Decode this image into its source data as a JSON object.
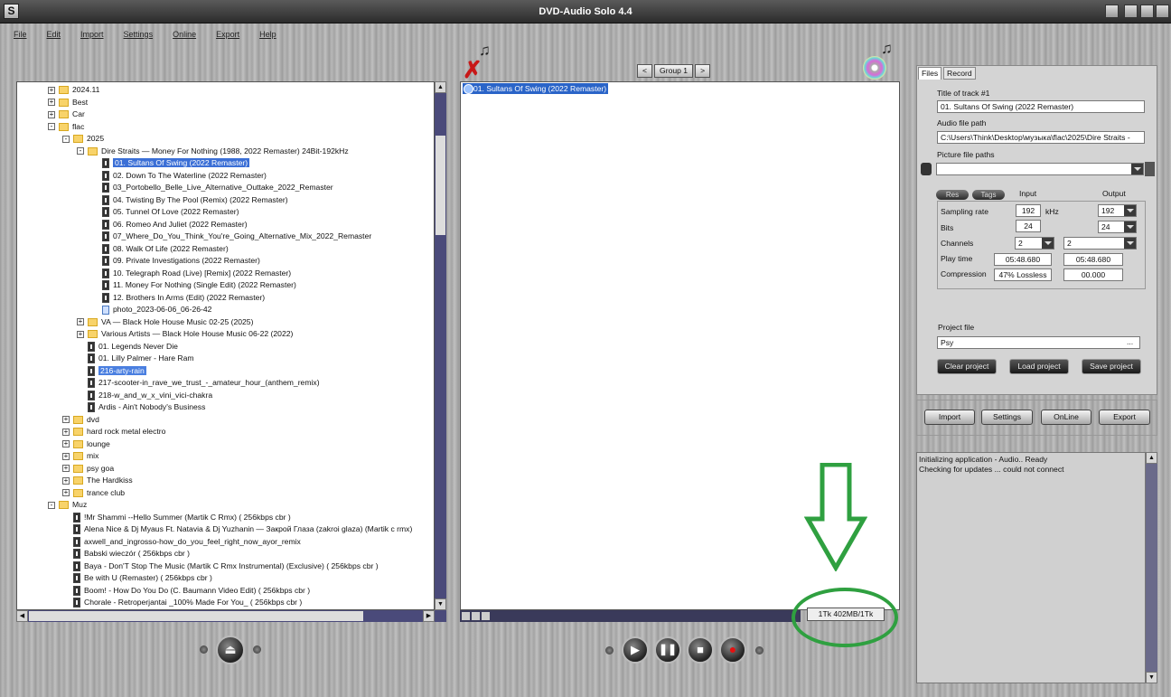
{
  "app": {
    "title": "DVD-Audio Solo 4.4",
    "logo_letter": "S"
  },
  "menu": [
    "File",
    "Edit",
    "Import",
    "Settings",
    "Online",
    "Export",
    "Help"
  ],
  "tree": {
    "rows": [
      {
        "t": "2024.11",
        "type": "folder",
        "lvl": 2,
        "pm": "+"
      },
      {
        "t": "Best",
        "type": "folder",
        "lvl": 2,
        "pm": "+"
      },
      {
        "t": "Car",
        "type": "folder",
        "lvl": 2,
        "pm": "+"
      },
      {
        "t": "flac",
        "type": "folder",
        "lvl": 2,
        "pm": "-"
      },
      {
        "t": "2025",
        "type": "folder",
        "lvl": 3,
        "pm": "-"
      },
      {
        "t": "Dire Straits — Money For Nothing (1988, 2022 Remaster) 24Bit-192kHz",
        "type": "folder",
        "lvl": 4,
        "pm": "-"
      },
      {
        "t": "01. Sultans Of Swing (2022 Remaster)",
        "type": "file",
        "lvl": 5,
        "sel": 1
      },
      {
        "t": "02. Down To The Waterline (2022 Remaster)",
        "type": "file",
        "lvl": 5
      },
      {
        "t": "03_Portobello_Belle_Live_Alternative_Outtake_2022_Remaster",
        "type": "file",
        "lvl": 5
      },
      {
        "t": "04. Twisting By The Pool (Remix) (2022 Remaster)",
        "type": "file",
        "lvl": 5
      },
      {
        "t": "05. Tunnel Of Love (2022 Remaster)",
        "type": "file",
        "lvl": 5
      },
      {
        "t": "06. Romeo And Juliet (2022 Remaster)",
        "type": "file",
        "lvl": 5
      },
      {
        "t": "07_Where_Do_You_Think_You're_Going_Alternative_Mix_2022_Remaster",
        "type": "file",
        "lvl": 5
      },
      {
        "t": "08. Walk Of Life (2022 Remaster)",
        "type": "file",
        "lvl": 5
      },
      {
        "t": "09. Private Investigations (2022 Remaster)",
        "type": "file",
        "lvl": 5
      },
      {
        "t": "10. Telegraph Road (Live) [Remix] (2022 Remaster)",
        "type": "file",
        "lvl": 5
      },
      {
        "t": "11. Money For Nothing (Single Edit) (2022 Remaster)",
        "type": "file",
        "lvl": 5
      },
      {
        "t": "12. Brothers In Arms (Edit) (2022 Remaster)",
        "type": "file",
        "lvl": 5
      },
      {
        "t": "photo_2023-06-06_06-26-42",
        "type": "image",
        "lvl": 5
      },
      {
        "t": "VA — Black Hole House Music 02-25 (2025)",
        "type": "folder",
        "lvl": 4,
        "pm": "+"
      },
      {
        "t": "Various Artists — Black Hole House Music 06-22 (2022)",
        "type": "folder",
        "lvl": 4,
        "pm": "+"
      },
      {
        "t": "01. Legends Never Die",
        "type": "file",
        "lvl": 4
      },
      {
        "t": "01. Lilly Palmer - Hare Ram",
        "type": "file",
        "lvl": 4
      },
      {
        "t": "216-arty-rain",
        "type": "file",
        "lvl": 4,
        "sel": 2
      },
      {
        "t": "217-scooter-in_rave_we_trust_-_amateur_hour_(anthem_remix)",
        "type": "file",
        "lvl": 4
      },
      {
        "t": "218-w_and_w_x_vini_vici-chakra",
        "type": "file",
        "lvl": 4
      },
      {
        "t": "Ardis - Ain't Nobody's Business",
        "type": "file",
        "lvl": 4
      },
      {
        "t": "dvd",
        "type": "folder",
        "lvl": 3,
        "pm": "+"
      },
      {
        "t": "hard rock metal electro",
        "type": "folder",
        "lvl": 3,
        "pm": "+"
      },
      {
        "t": "lounge",
        "type": "folder",
        "lvl": 3,
        "pm": "+"
      },
      {
        "t": "mix",
        "type": "folder",
        "lvl": 3,
        "pm": "+"
      },
      {
        "t": "psy goa",
        "type": "folder",
        "lvl": 3,
        "pm": "+"
      },
      {
        "t": "The Hardkiss",
        "type": "folder",
        "lvl": 3,
        "pm": "+"
      },
      {
        "t": "trance club",
        "type": "folder",
        "lvl": 3,
        "pm": "+"
      },
      {
        "t": "Muz",
        "type": "folder",
        "lvl": 2,
        "pm": "-"
      },
      {
        "t": "!Mr Shammi --Hello Summer (Martik C Rmx) ( 256kbps cbr )",
        "type": "file",
        "lvl": 3
      },
      {
        "t": "Alena Nice & Dj Myaus Ft. Natavia & Dj Yuzhanin — Закрой Глаза (zakroi glaza) (Martik c rmx)",
        "type": "file",
        "lvl": 3
      },
      {
        "t": "axwell_and_ingrosso-how_do_you_feel_right_now_ayor_remix",
        "type": "file",
        "lvl": 3
      },
      {
        "t": "Babski wieczór ( 256kbps cbr )",
        "type": "file",
        "lvl": 3
      },
      {
        "t": "Baya - Don'T Stop The Music (Martik C Rmx Instrumental) (Exclusive) ( 256kbps cbr )",
        "type": "file",
        "lvl": 3
      },
      {
        "t": "Be with U (Remaster) ( 256kbps cbr )",
        "type": "file",
        "lvl": 3
      },
      {
        "t": "Boom! - How Do You Do (C. Baumann Video Edit) ( 256kbps cbr )",
        "type": "file",
        "lvl": 3
      },
      {
        "t": "Chorale - Retroperjantai _100% Made For You_ ( 256kbps cbr )",
        "type": "file",
        "lvl": 3
      }
    ]
  },
  "group": {
    "prev": "<",
    "label": "Group 1",
    "next": ">"
  },
  "tracks": {
    "selected": "01. Sultans Of Swing (2022 Remaster)"
  },
  "status": {
    "size": "1Tk 402MB/1Tk"
  },
  "tabs": {
    "files": "Files",
    "record": "Record"
  },
  "props": {
    "title_label": "Title of track #1",
    "title_value": "01. Sultans Of Swing (2022 Remaster)",
    "audio_label": "Audio file path",
    "audio_value": "C:\\Users\\Think\\Desktop\\музыка\\flac\\2025\\Dire Straits -",
    "picture_label": "Picture file paths",
    "picture_value": "",
    "res_btn": "Res",
    "tags_btn": "Tags",
    "input_hdr": "Input",
    "output_hdr": "Output",
    "sampling_label": "Sampling rate",
    "sampling_in": "192",
    "khz": "kHz",
    "sampling_out": "192",
    "bits_label": "Bits",
    "bits_in": "24",
    "bits_out": "24",
    "channels_label": "Channels",
    "channels_in": "2",
    "channels_out": "2",
    "playtime_label": "Play time",
    "playtime_in": "05:48.680",
    "playtime_out": "05:48.680",
    "compression_label": "Compression",
    "compression_in": "47% Lossless",
    "compression_out": "00.000",
    "project_label": "Project file",
    "project_value": "Psy",
    "project_browse": "...",
    "clear": "Clear project",
    "load": "Load project",
    "save": "Save project"
  },
  "bottom": {
    "import": "Import",
    "settings": "Settings",
    "online": "OnLine",
    "export": "Export"
  },
  "log": {
    "line1": "Initializing application - Audio.. Ready",
    "line2": "Checking for updates ... could not connect"
  },
  "annotation_color": "#2fa040"
}
